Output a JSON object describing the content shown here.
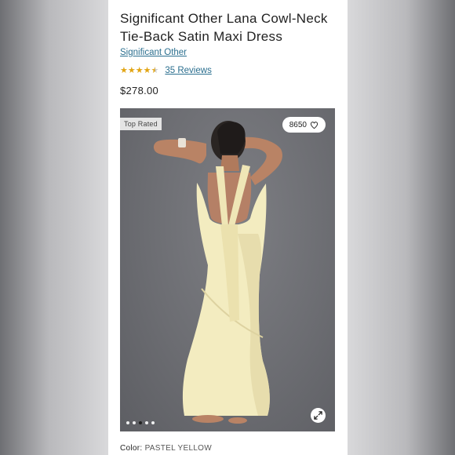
{
  "product": {
    "title": "Significant Other Lana Cowl-Neck Tie-Back Satin Maxi Dress",
    "brand": "Significant Other",
    "rating": 4.5,
    "reviews_label": "35 Reviews",
    "price": "$278.00"
  },
  "gallery": {
    "badge": "Top Rated",
    "likes": "8650",
    "image_count": 5,
    "active_index": 2
  },
  "color": {
    "label": "Color:",
    "value": "PASTEL YELLOW"
  },
  "colors": {
    "link": "#2b6f8f",
    "star": "#e2a514",
    "dress": "#f3ecc0"
  }
}
